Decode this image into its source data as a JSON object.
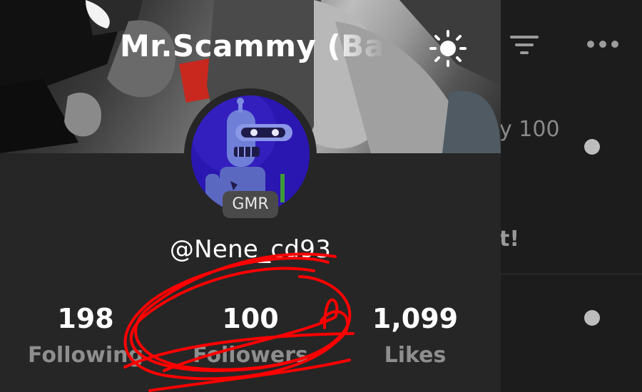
{
  "header": {
    "title": "Mr.Scammy (Batte",
    "actions": [
      {
        "name": "theme-toggle",
        "icon": "sun-icon"
      },
      {
        "name": "filter",
        "icon": "filter-icon"
      },
      {
        "name": "more",
        "icon": "more-horizontal-icon"
      }
    ]
  },
  "profile": {
    "badge": "GMR",
    "handle": "@Nene_cd93",
    "stats": [
      {
        "value": "198",
        "label": "Following"
      },
      {
        "value": "100",
        "label": "Followers"
      },
      {
        "value": "1,099",
        "label": "Likes"
      }
    ]
  },
  "background_list": {
    "rows": [
      {
        "text": "y 100"
      },
      {
        "text": "t!"
      }
    ]
  },
  "annotation": {
    "color": "#ff0000"
  },
  "colors": {
    "sheet_bg": "#262626",
    "stat_label": "#8e8e8e",
    "badge_bg": "#4a4a4a"
  }
}
